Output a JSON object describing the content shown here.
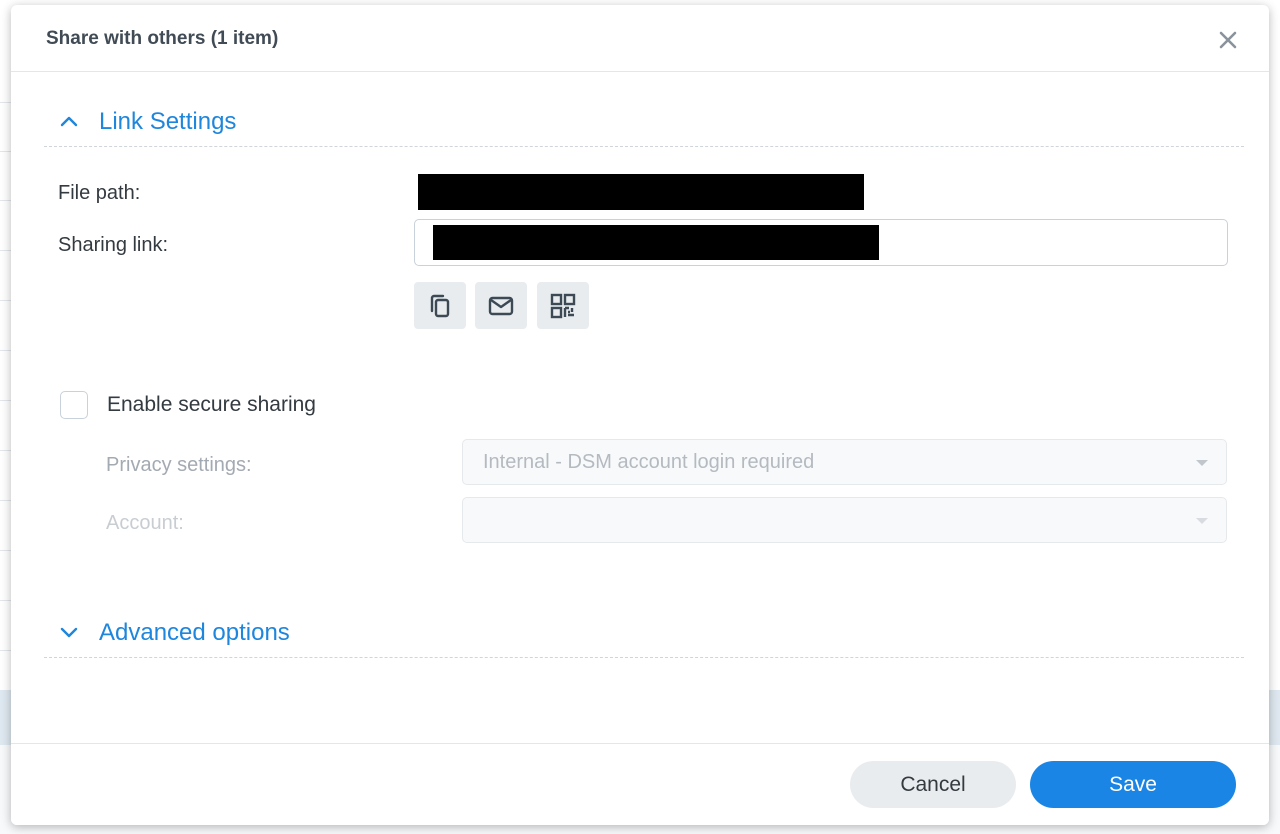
{
  "dialog": {
    "title": "Share with others (1 item)",
    "close_icon": "close-icon"
  },
  "link_settings": {
    "header": "Link Settings",
    "expanded": true,
    "file_path_label": "File path:",
    "sharing_link_label": "Sharing link:",
    "actions": [
      {
        "name": "copy-link-button",
        "icon": "copy-icon"
      },
      {
        "name": "email-link-button",
        "icon": "mail-icon"
      },
      {
        "name": "qr-code-button",
        "icon": "qr-code-icon"
      }
    ]
  },
  "secure_sharing": {
    "checkbox_label": "Enable secure sharing",
    "checked": false,
    "privacy_label": "Privacy settings:",
    "privacy_value": "Internal - DSM account login required",
    "account_label": "Account:",
    "account_value": ""
  },
  "advanced": {
    "header": "Advanced options",
    "expanded": false
  },
  "footer": {
    "cancel_label": "Cancel",
    "save_label": "Save"
  },
  "colors": {
    "accent": "#1e86dc",
    "save_button": "#1a85e5",
    "secondary_button": "#e8ecef"
  }
}
